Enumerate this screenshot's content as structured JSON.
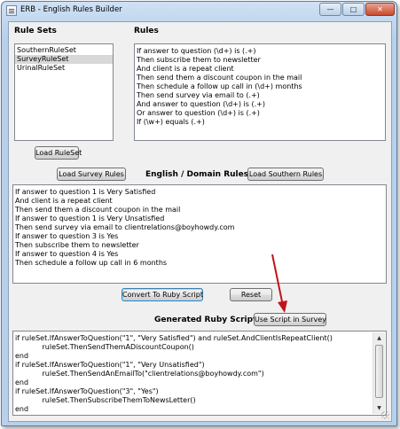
{
  "window": {
    "title": "ERB - English Rules Builder"
  },
  "window_controls": {
    "minimize": "—",
    "maximize": "□",
    "close": "✕"
  },
  "rule_sets": {
    "header": "Rule Sets",
    "items": [
      "SouthernRuleSet",
      "SurveyRuleSet",
      "UrinalRuleSet"
    ],
    "selected_index": 1,
    "load_button": "Load RuleSet"
  },
  "rules": {
    "header": "Rules",
    "items": [
      "If answer to question (\\d+) is (.+)",
      "Then subscribe them to newsletter",
      "And client is a repeat client",
      "Then send them a discount coupon in the mail",
      "Then schedule a follow up call in (\\d+) months",
      "Then send survey via email to (.+)",
      "And answer to question (\\d+) is (.+)",
      "Or answer to question (\\d+) is (.+)",
      "If (\\w+) equals (.+)"
    ]
  },
  "english": {
    "load_survey_button": "Load Survey Rules",
    "header": "English / Domain Rules",
    "load_southern_button": "Load Southern Rules",
    "text": "If answer to question 1 is Very Satisfied\nAnd client is a repeat client\nThen send them a discount coupon in the mail\nIf answer to question 1 is Very Unsatisfied\nThen send survey via email to clientrelations@boyhowdy.com\nIf answer to question 3 is Yes\nThen subscribe them to newsletter\nIf answer to question 4 is Yes\nThen schedule a follow up call in 6 months",
    "convert_button": "Convert To Ruby Script",
    "reset_button": "Reset"
  },
  "ruby": {
    "header": "Generated Ruby Script",
    "use_button": "Use Script in Survey",
    "text": "if ruleSet.IfAnswerToQuestion(\"1\", \"Very Satisfied\") and ruleSet.AndClientIsRepeatClient()\n            ruleSet.ThenSendThemADiscountCoupon()\nend\nif ruleSet.IfAnswerToQuestion(\"1\", \"Very Unsatisfied\")\n            ruleSet.ThenSendAnEmailTo(\"clientrelations@boyhowdy.com\")\nend\nif ruleSet.IfAnswerToQuestion(\"3\", \"Yes\")\n            ruleSet.ThenSubscribeThemToNewsLetter()\nend"
  },
  "annotation": {
    "arrow_color": "#c0141b"
  },
  "icons": {
    "app": "app-icon",
    "scroll_up": "scroll-up-arrow-icon",
    "scroll_down": "scroll-down-arrow-icon"
  }
}
